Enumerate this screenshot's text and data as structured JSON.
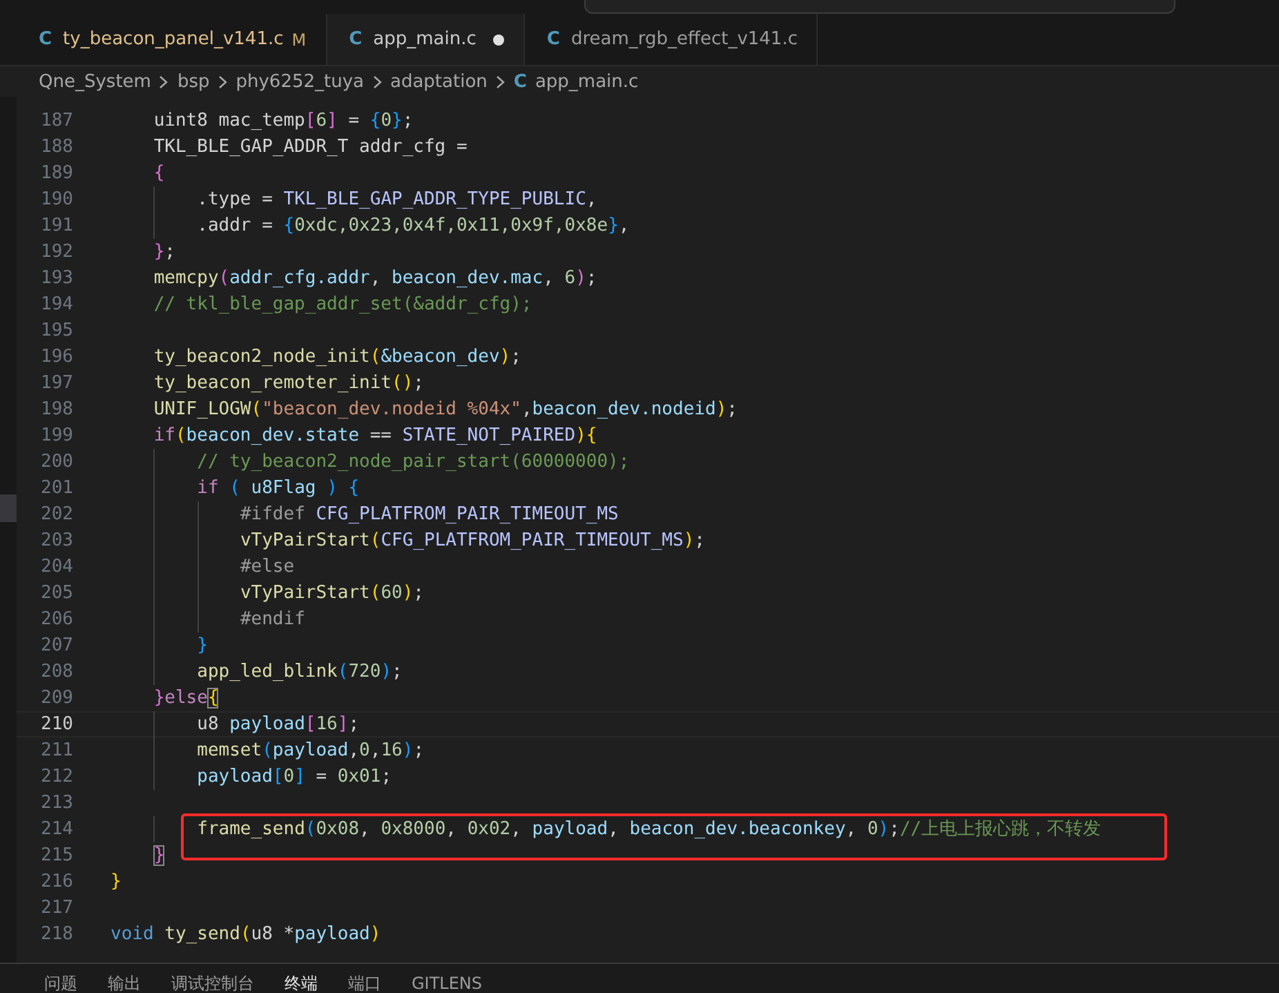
{
  "tabs": [
    {
      "icon": "C",
      "label": "ty_beacon_panel_v141.c",
      "badge": "M",
      "selected": false,
      "unsaved": false
    },
    {
      "icon": "C",
      "label": "app_main.c",
      "selected": true,
      "unsaved": true
    },
    {
      "icon": "C",
      "label": "dream_rgb_effect_v141.c",
      "selected": false,
      "unsaved": false
    }
  ],
  "breadcrumb": [
    {
      "text": "Qne_System"
    },
    {
      "text": "bsp"
    },
    {
      "text": "phy6252_tuya"
    },
    {
      "text": "adaptation"
    },
    {
      "icon": "C",
      "text": "app_main.c"
    }
  ],
  "editor": {
    "lines": [
      {
        "number": "187",
        "tokens": [
          {
            "kind": "plain",
            "text": "    uint8 mac_temp"
          },
          {
            "kind": "br2",
            "text": "["
          },
          {
            "kind": "num",
            "text": "6"
          },
          {
            "kind": "br2",
            "text": "]"
          },
          {
            "kind": "plain",
            "text": " = "
          },
          {
            "kind": "br3",
            "text": "{"
          },
          {
            "kind": "num",
            "text": "0"
          },
          {
            "kind": "br3",
            "text": "}"
          },
          {
            "kind": "plain",
            "text": ";"
          }
        ]
      },
      {
        "number": "188",
        "tokens": [
          {
            "kind": "plain",
            "text": "    TKL_BLE_GAP_ADDR_T addr_cfg ="
          }
        ]
      },
      {
        "number": "189",
        "tokens": [
          {
            "kind": "br2",
            "text": "    {"
          }
        ]
      },
      {
        "number": "190",
        "tokens": [
          {
            "kind": "plain",
            "text": "        .type = "
          },
          {
            "kind": "macro",
            "text": "TKL_BLE_GAP_ADDR_TYPE_PUBLIC"
          },
          {
            "kind": "plain",
            "text": ","
          }
        ]
      },
      {
        "number": "191",
        "tokens": [
          {
            "kind": "plain",
            "text": "        .addr = "
          },
          {
            "kind": "br3",
            "text": "{"
          },
          {
            "kind": "num",
            "text": "0xdc,0x23,0x4f,0x11,0x9f,0x8e"
          },
          {
            "kind": "br3",
            "text": "}"
          },
          {
            "kind": "plain",
            "text": ","
          }
        ]
      },
      {
        "number": "192",
        "tokens": [
          {
            "kind": "br2",
            "text": "    }"
          },
          {
            "kind": "plain",
            "text": ";"
          }
        ]
      },
      {
        "number": "193",
        "tokens": [
          {
            "kind": "fn",
            "text": "    memcpy"
          },
          {
            "kind": "br2",
            "text": "("
          },
          {
            "kind": "var",
            "text": "addr_cfg.addr"
          },
          {
            "kind": "plain",
            "text": ", "
          },
          {
            "kind": "var",
            "text": "beacon_dev.mac"
          },
          {
            "kind": "plain",
            "text": ", "
          },
          {
            "kind": "num",
            "text": "6"
          },
          {
            "kind": "br2",
            "text": ")"
          },
          {
            "kind": "plain",
            "text": ";"
          }
        ]
      },
      {
        "number": "194",
        "tokens": [
          {
            "kind": "cmt",
            "text": "    // tkl_ble_gap_addr_set(&addr_cfg);"
          }
        ]
      },
      {
        "number": "195"
      },
      {
        "number": "196",
        "tokens": [
          {
            "kind": "fn",
            "text": "    ty_beacon2_node_init"
          },
          {
            "kind": "br1",
            "text": "("
          },
          {
            "kind": "var",
            "text": "&beacon_dev"
          },
          {
            "kind": "br1",
            "text": ")"
          },
          {
            "kind": "plain",
            "text": ";"
          }
        ]
      },
      {
        "number": "197",
        "tokens": [
          {
            "kind": "fn",
            "text": "    ty_beacon_remoter_init"
          },
          {
            "kind": "br1",
            "text": "()"
          },
          {
            "kind": "plain",
            "text": ";"
          }
        ]
      },
      {
        "number": "198",
        "tokens": [
          {
            "kind": "fn",
            "text": "    UNIF_LOGW"
          },
          {
            "kind": "br1",
            "text": "("
          },
          {
            "kind": "str",
            "text": "\"beacon_dev.nodeid %04x\""
          },
          {
            "kind": "plain",
            "text": ","
          },
          {
            "kind": "var",
            "text": "beacon_dev.nodeid"
          },
          {
            "kind": "br1",
            "text": ")"
          },
          {
            "kind": "plain",
            "text": ";"
          }
        ]
      },
      {
        "number": "199",
        "tokens": [
          {
            "kind": "kw",
            "text": "    if"
          },
          {
            "kind": "br1",
            "text": "("
          },
          {
            "kind": "var",
            "text": "beacon_dev.state"
          },
          {
            "kind": "plain",
            "text": " == "
          },
          {
            "kind": "macro",
            "text": "STATE_NOT_PAIRED"
          },
          {
            "kind": "br1",
            "text": "){"
          }
        ]
      },
      {
        "number": "200",
        "tokens": [
          {
            "kind": "cmt",
            "text": "        // ty_beacon2_node_pair_start(60000000);"
          }
        ]
      },
      {
        "number": "201",
        "tokens": [
          {
            "kind": "kw",
            "text": "        if"
          },
          {
            "kind": "br3",
            "text": " ("
          },
          {
            "kind": "var",
            "text": " u8Flag "
          },
          {
            "kind": "br3",
            "text": ")"
          },
          {
            "kind": "br3",
            "text": " {"
          }
        ]
      },
      {
        "number": "202",
        "tokens": [
          {
            "kind": "pre",
            "text": "            #ifdef"
          },
          {
            "kind": "macro",
            "text": " CFG_PLATFROM_PAIR_TIMEOUT_MS"
          }
        ]
      },
      {
        "number": "203",
        "tokens": [
          {
            "kind": "fn",
            "text": "            vTyPairStart"
          },
          {
            "kind": "br1",
            "text": "("
          },
          {
            "kind": "macro",
            "text": "CFG_PLATFROM_PAIR_TIMEOUT_MS"
          },
          {
            "kind": "br1",
            "text": ")"
          },
          {
            "kind": "plain",
            "text": ";"
          }
        ]
      },
      {
        "number": "204",
        "tokens": [
          {
            "kind": "pre",
            "text": "            #else"
          }
        ]
      },
      {
        "number": "205",
        "tokens": [
          {
            "kind": "fn",
            "text": "            vTyPairStart"
          },
          {
            "kind": "br1",
            "text": "("
          },
          {
            "kind": "num",
            "text": "60"
          },
          {
            "kind": "br1",
            "text": ")"
          },
          {
            "kind": "plain",
            "text": ";"
          }
        ]
      },
      {
        "number": "206",
        "tokens": [
          {
            "kind": "pre",
            "text": "            #endif"
          }
        ]
      },
      {
        "number": "207",
        "tokens": [
          {
            "kind": "br3",
            "text": "        }"
          }
        ]
      },
      {
        "number": "208",
        "tokens": [
          {
            "kind": "fn",
            "text": "        app_led_blink"
          },
          {
            "kind": "br3",
            "text": "("
          },
          {
            "kind": "num",
            "text": "720"
          },
          {
            "kind": "br3",
            "text": ")"
          },
          {
            "kind": "plain",
            "text": ";"
          }
        ]
      },
      {
        "number": "209",
        "tokens": [
          {
            "kind": "br2",
            "text": "    }"
          },
          {
            "kind": "kw",
            "text": "else"
          },
          {
            "kind": "br1",
            "text": "{",
            "matched": true
          }
        ]
      },
      {
        "number": "210",
        "current": true,
        "tokens": [
          {
            "kind": "plain",
            "text": "        u8 "
          },
          {
            "kind": "var",
            "text": "payload"
          },
          {
            "kind": "br2",
            "text": "["
          },
          {
            "kind": "num",
            "text": "16"
          },
          {
            "kind": "br2",
            "text": "]"
          },
          {
            "kind": "plain",
            "text": ";"
          }
        ]
      },
      {
        "number": "211",
        "tokens": [
          {
            "kind": "fn",
            "text": "        memset"
          },
          {
            "kind": "br3",
            "text": "("
          },
          {
            "kind": "var",
            "text": "payload"
          },
          {
            "kind": "plain",
            "text": ","
          },
          {
            "kind": "num",
            "text": "0"
          },
          {
            "kind": "plain",
            "text": ","
          },
          {
            "kind": "num",
            "text": "16"
          },
          {
            "kind": "br3",
            "text": ")"
          },
          {
            "kind": "plain",
            "text": ";"
          }
        ]
      },
      {
        "number": "212",
        "tokens": [
          {
            "kind": "var",
            "text": "        payload"
          },
          {
            "kind": "br3",
            "text": "["
          },
          {
            "kind": "num",
            "text": "0"
          },
          {
            "kind": "br3",
            "text": "]"
          },
          {
            "kind": "plain",
            "text": " = "
          },
          {
            "kind": "num",
            "text": "0x01"
          },
          {
            "kind": "plain",
            "text": ";"
          }
        ]
      },
      {
        "number": "213"
      },
      {
        "number": "214",
        "highlighted": true,
        "tokens": [
          {
            "kind": "fn",
            "text": "        frame_send"
          },
          {
            "kind": "br3",
            "text": "("
          },
          {
            "kind": "num",
            "text": "0x08"
          },
          {
            "kind": "plain",
            "text": ", "
          },
          {
            "kind": "num",
            "text": "0x8000"
          },
          {
            "kind": "plain",
            "text": ", "
          },
          {
            "kind": "num",
            "text": "0x02"
          },
          {
            "kind": "plain",
            "text": ", "
          },
          {
            "kind": "var",
            "text": "payload"
          },
          {
            "kind": "plain",
            "text": ", "
          },
          {
            "kind": "var",
            "text": "beacon_dev.beaconkey"
          },
          {
            "kind": "plain",
            "text": ", "
          },
          {
            "kind": "num",
            "text": "0"
          },
          {
            "kind": "br3",
            "text": ")"
          },
          {
            "kind": "plain",
            "text": ";"
          },
          {
            "kind": "cmt",
            "text": "//上电上报心跳，不转发"
          }
        ]
      },
      {
        "number": "215",
        "tokens": [
          {
            "kind": "br2",
            "text": "    }",
            "matched": true
          }
        ]
      },
      {
        "number": "216",
        "tokens": [
          {
            "kind": "br1",
            "text": "}"
          }
        ]
      },
      {
        "number": "217"
      },
      {
        "number": "218",
        "tokens": [
          {
            "kind": "type",
            "text": "void"
          },
          {
            "kind": "fn",
            "text": " ty_send"
          },
          {
            "kind": "br1",
            "text": "("
          },
          {
            "kind": "plain",
            "text": "u8 *"
          },
          {
            "kind": "var",
            "text": "payload"
          },
          {
            "kind": "br1",
            "text": ")"
          }
        ]
      }
    ]
  },
  "panel_tabs": [
    {
      "label": "问题",
      "selected": false
    },
    {
      "label": "输出",
      "selected": false
    },
    {
      "label": "调试控制台",
      "selected": false
    },
    {
      "label": "终端",
      "selected": true
    },
    {
      "label": "端口",
      "selected": false
    },
    {
      "label": "GITLENS",
      "selected": false
    }
  ]
}
